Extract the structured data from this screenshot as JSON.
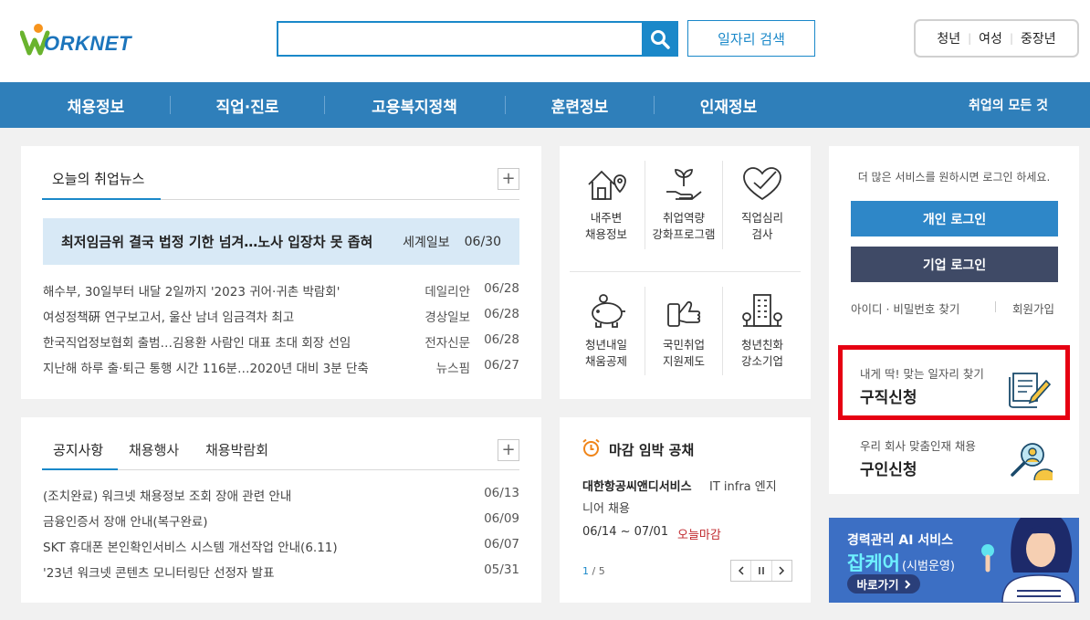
{
  "header": {
    "logo_text": "ORKNET",
    "search_placeholder": "",
    "job_search_label": "일자리 검색",
    "age_filters": [
      "청년",
      "여성",
      "중장년"
    ]
  },
  "nav": {
    "items": [
      "채용정보",
      "직업·진로",
      "고용복지정책",
      "훈련정보",
      "인재정보"
    ],
    "all_label": "취업의 모든 것"
  },
  "news": {
    "tab_label": "오늘의 취업뉴스",
    "highlight": {
      "title": "최저임금위 결국 법정 기한 넘겨…노사 입장차 못 좁혀",
      "source": "세계일보",
      "date": "06/30"
    },
    "items": [
      {
        "title": "해수부, 30일부터 내달 2일까지 '2023 귀어·귀촌 박람회'",
        "source": "데일리안",
        "date": "06/28"
      },
      {
        "title": "여성정책硏 연구보고서, 울산 남녀 임금격차 최고",
        "source": "경상일보",
        "date": "06/28"
      },
      {
        "title": "한국직업정보협회 출범…김용환 사람인 대표 초대 회장 선임",
        "source": "전자신문",
        "date": "06/28"
      },
      {
        "title": "지난해 하루 출·퇴근 통행 시간 116분…2020년 대비 3분 단축",
        "source": "뉴스핌",
        "date": "06/27"
      }
    ]
  },
  "notice": {
    "tabs": [
      "공지사항",
      "채용행사",
      "채용박람회"
    ],
    "items": [
      {
        "title": "(조치완료) 워크넷 채용정보 조회 장애 관련 안내",
        "date": "06/13"
      },
      {
        "title": "금융인증서 장애 안내(복구완료)",
        "date": "06/09"
      },
      {
        "title": "SKT 휴대폰 본인확인서비스 시스템 개선작업 안내(6.11)",
        "date": "06/07"
      },
      {
        "title": "'23년 워크넷 콘텐츠 모니터링단 선정자 발표",
        "date": "05/31"
      }
    ]
  },
  "services": [
    {
      "line1": "내주변",
      "line2": "채용정보",
      "icon": "house-location-icon"
    },
    {
      "line1": "취업역량",
      "line2": "강화프로그램",
      "icon": "sprout-hand-icon"
    },
    {
      "line1": "직업심리",
      "line2": "검사",
      "icon": "heart-check-icon"
    },
    {
      "line1": "청년내일",
      "line2": "채움공제",
      "icon": "piggy-bank-icon"
    },
    {
      "line1": "국민취업",
      "line2": "지원제도",
      "icon": "thumbs-up-phone-icon"
    },
    {
      "line1": "청년친화",
      "line2": "강소기업",
      "icon": "building-icon"
    }
  ],
  "deadline": {
    "title": "마감 임박 공채",
    "company": "대한항공씨앤디서비스",
    "job_line1": "IT infra 엔지",
    "job_line2": "니어 채용",
    "period": "06/14 ~ 07/01",
    "status": "오늘마감",
    "page_current": "1",
    "page_sep": " / ",
    "page_total": "5"
  },
  "login": {
    "notice": "더 많은 서비스를 원하시면 로그인 하세요.",
    "personal_label": "개인 로그인",
    "corporate_label": "기업 로그인",
    "find_label": "아이디 · 비밀번호 찾기",
    "join_label": "회원가입"
  },
  "job_seek": {
    "small": "내게 딱! 맞는 일자리 찾기",
    "big": "구직신청"
  },
  "recruit": {
    "small": "우리 회사 맞춤인재 채용",
    "big": "구인신청"
  },
  "banner": {
    "line1": "경력관리 AI 서비스",
    "line2_main": "잡케어",
    "line2_sub": "(시범운영)",
    "button": "바로가기"
  },
  "colors": {
    "primary": "#1a88c9",
    "nav": "#2f7fba",
    "corporate": "#3f4a66",
    "highlight_border": "#e60012"
  }
}
